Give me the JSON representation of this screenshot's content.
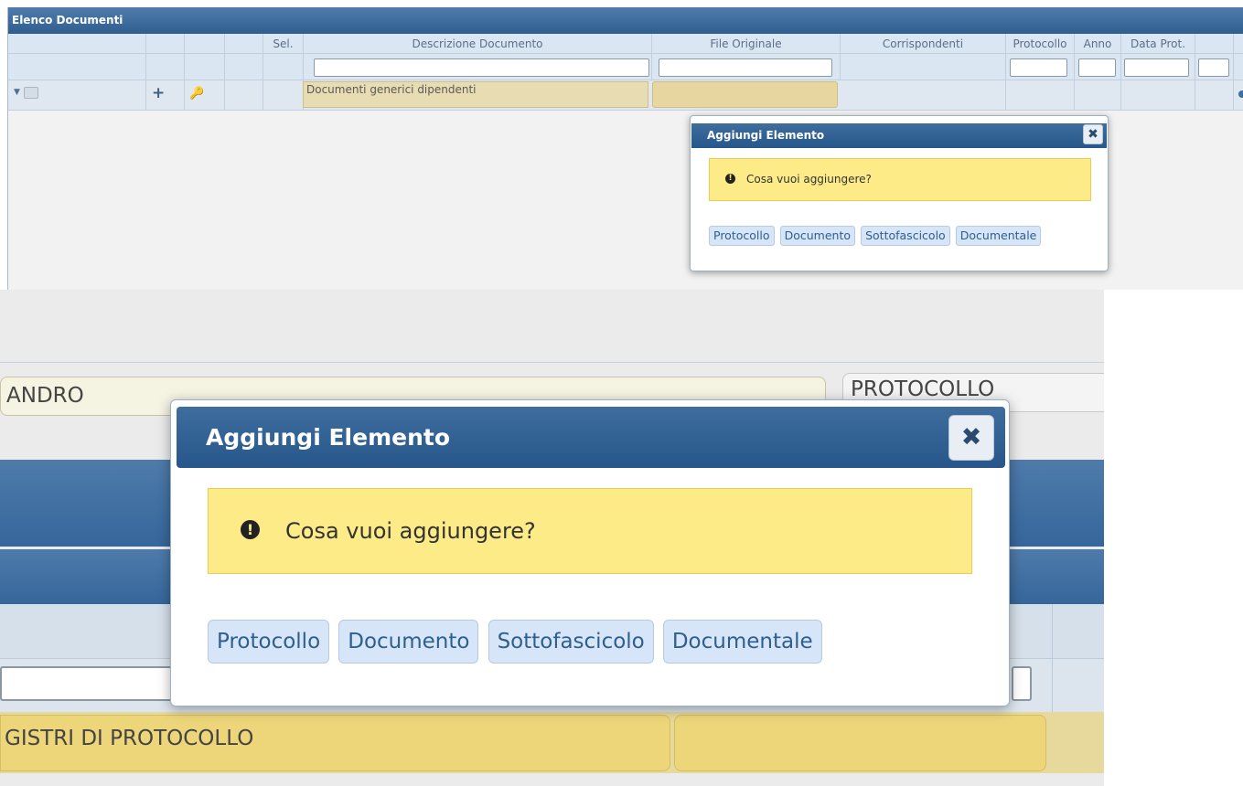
{
  "panel": {
    "title": "Elenco Documenti",
    "columns": [
      "",
      "",
      "",
      "",
      "Sel.",
      "Descrizione Documento",
      "File Originale",
      "Corrispondenti",
      "Protocollo",
      "Anno",
      "Data Prot.",
      ""
    ],
    "row": {
      "description": "Documenti generici dipendenti",
      "add_glyph": "+",
      "key_glyph": "key-icon"
    }
  },
  "dialog": {
    "title": "Aggiungi Elemento",
    "close_glyph": "✖",
    "message": "Cosa vuoi aggiungere?",
    "alert_glyph": "!",
    "buttons": [
      "Protocollo",
      "Documento",
      "Sottofascicolo",
      "Documentale"
    ]
  },
  "zoom_background": {
    "field_left": "ANDRO",
    "field_right": "PROTOCOLLO",
    "row_text": "GISTRI DI PROTOCOLLO"
  },
  "colors": {
    "title_bar": "#2f5e8f",
    "message_bg": "#fdeb88",
    "button_bg": "#d6e5f7",
    "row_highlight": "#edd57a"
  }
}
